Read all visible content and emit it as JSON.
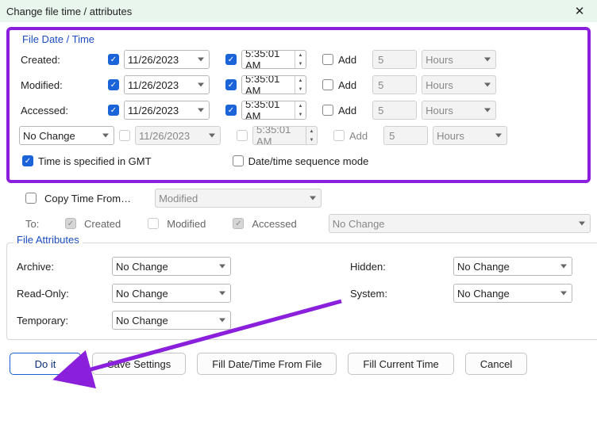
{
  "window": {
    "title": "Change file time / attributes",
    "close": "✕"
  },
  "filedate": {
    "heading": "File Date / Time",
    "rows": [
      {
        "label": "Created:",
        "dateOn": true,
        "date": "11/26/2023",
        "timeOn": true,
        "time": "5:35:01 AM",
        "addOn": false,
        "add": "Add",
        "val": "5",
        "unit": "Hours",
        "enabled": true
      },
      {
        "label": "Modified:",
        "dateOn": true,
        "date": "11/26/2023",
        "timeOn": true,
        "time": "5:35:01 AM",
        "addOn": false,
        "add": "Add",
        "val": "5",
        "unit": "Hours",
        "enabled": true
      },
      {
        "label": "Accessed:",
        "dateOn": true,
        "date": "11/26/2023",
        "timeOn": true,
        "time": "5:35:01 AM",
        "addOn": false,
        "add": "Add",
        "val": "5",
        "unit": "Hours",
        "enabled": true
      },
      {
        "label_select": "No Change",
        "dateOn": false,
        "date": "11/26/2023",
        "timeOn": false,
        "time": "5:35:01 AM",
        "addOn": false,
        "add": "Add",
        "val": "5",
        "unit": "Hours",
        "enabled": false
      }
    ],
    "gmt": {
      "checked": true,
      "label": "Time is specified in GMT"
    },
    "seq": {
      "checked": false,
      "label": "Date/time sequence mode"
    }
  },
  "copy": {
    "from": {
      "checked": false,
      "label": "Copy Time From…",
      "value": "Modified"
    },
    "toLabel": "To:",
    "created": {
      "label": "Created",
      "checked": true
    },
    "modified": {
      "label": "Modified",
      "checked": false
    },
    "accessed": {
      "label": "Accessed",
      "checked": true
    },
    "mode": "No Change"
  },
  "attrs": {
    "heading": "File Attributes",
    "archive": {
      "label": "Archive:",
      "value": "No Change"
    },
    "readonly": {
      "label": "Read-Only:",
      "value": "No Change"
    },
    "temporary": {
      "label": "Temporary:",
      "value": "No Change"
    },
    "hidden": {
      "label": "Hidden:",
      "value": "No Change"
    },
    "system": {
      "label": "System:",
      "value": "No Change"
    }
  },
  "buttons": {
    "doit": "Do it",
    "save": "Save Settings",
    "fillFile": "Fill Date/Time From File",
    "fillNow": "Fill Current Time",
    "cancel": "Cancel"
  }
}
